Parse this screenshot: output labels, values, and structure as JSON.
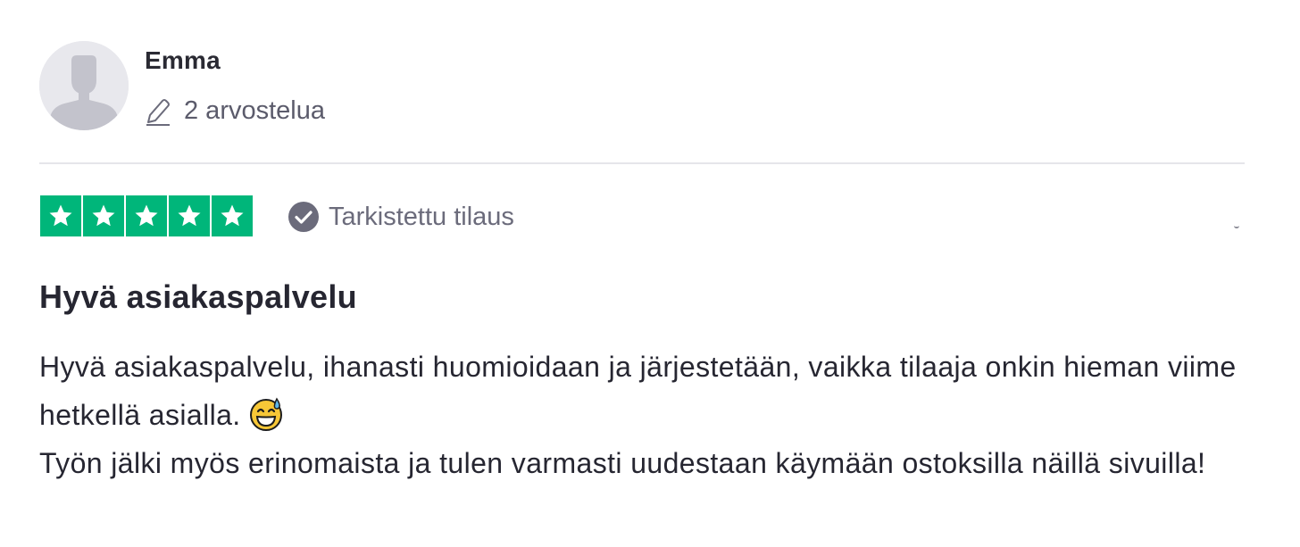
{
  "reviewer": {
    "name": "Emma",
    "review_count": "2 arvostelua",
    "avatar_icon": "default-user-silhouette"
  },
  "rating": {
    "stars": 5,
    "max_stars": 5,
    "color": "#00b67a",
    "verified_label": "Tarkistettu tilaus"
  },
  "review": {
    "title": "Hyvä asiakaspalvelu",
    "body_line1": "Hyvä asiakaspalvelu, ihanasti huomioidaan ja järjestetään, vaikka tilaaja onkin hieman viime hetkellä asialla.",
    "body_line1_emoji": "grinning-face-with-sweat",
    "body_line2": "Työn jälki myös erinomaista ja tulen varmasti uudestaan käymään ostoksilla näillä sivuilla!"
  }
}
